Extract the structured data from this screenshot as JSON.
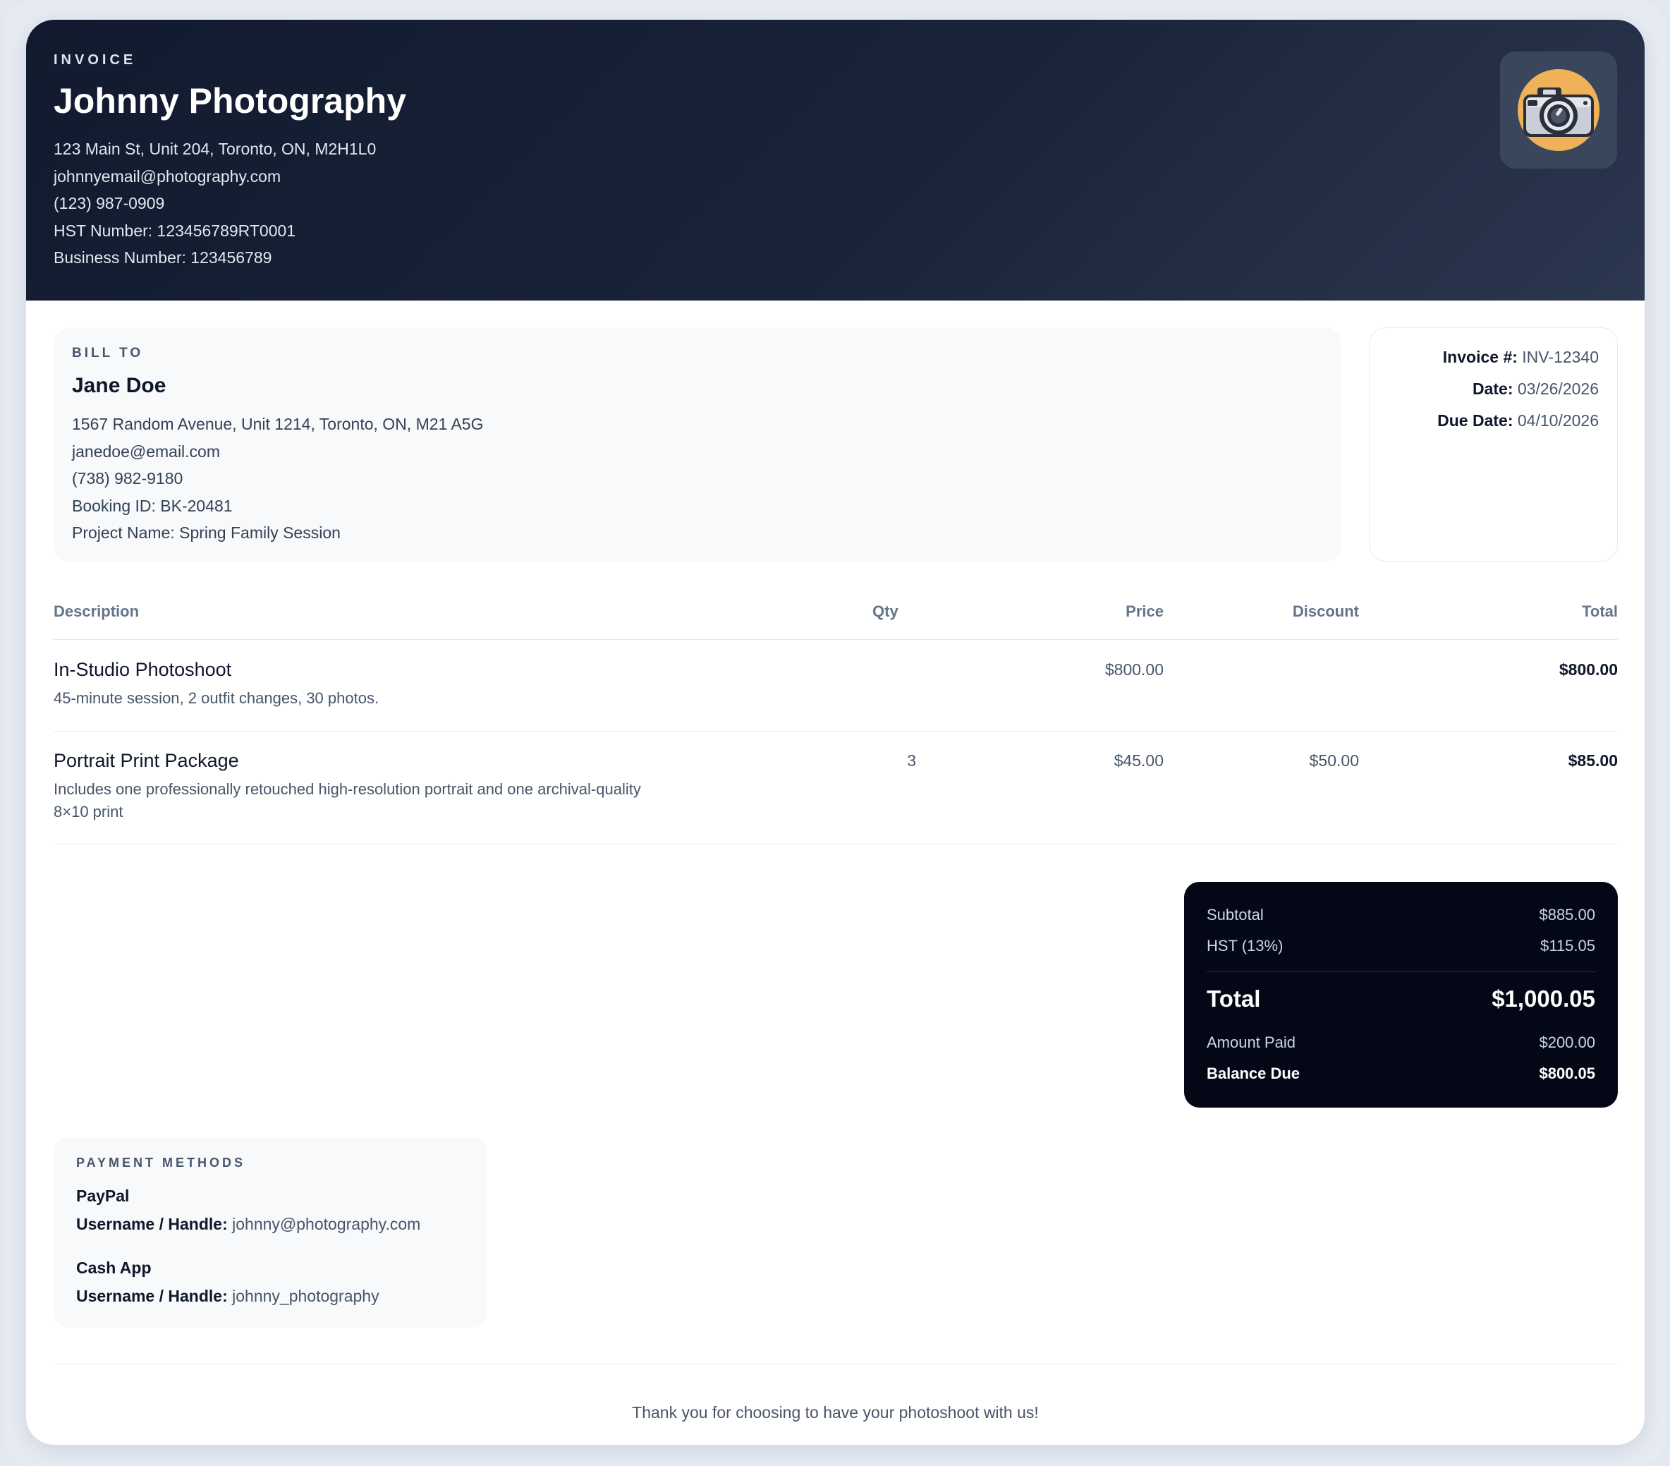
{
  "business": {
    "eyebrow": "INVOICE",
    "name": "Johnny Photography",
    "address": "123 Main St, Unit 204, Toronto, ON, M2H1L0",
    "email": "johnnyemail@photography.com",
    "phone": "(123) 987-0909",
    "hst": "HST Number: 123456789RT0001",
    "business_number": "Business Number: 123456789",
    "logo_icon": "camera-icon"
  },
  "bill_to": {
    "label": "BILL TO",
    "name": "Jane Doe",
    "address": "1567 Random Avenue, Unit 1214, Toronto, ON, M21 A5G",
    "email": "janedoe@email.com",
    "phone": "(738) 982-9180",
    "booking": "Booking ID: BK-20481",
    "project": "Project Name: Spring Family Session"
  },
  "meta": {
    "invoice_label": "Invoice #:",
    "invoice_value": "INV-12340",
    "date_label": "Date:",
    "date_value": "03/26/2026",
    "due_label": "Due Date:",
    "due_value": "04/10/2026"
  },
  "table": {
    "headers": {
      "description": "Description",
      "qty": "Qty",
      "price": "Price",
      "discount": "Discount",
      "total": "Total"
    },
    "rows": [
      {
        "title": "In-Studio Photoshoot",
        "desc": "45-minute session, 2 outfit changes, 30 photos.",
        "qty": "",
        "price": "$800.00",
        "discount": "",
        "total": "$800.00"
      },
      {
        "title": "Portrait Print Package",
        "desc": "Includes one professionally retouched high-resolution portrait and one archival-quality 8×10 print",
        "qty": "3",
        "price": "$45.00",
        "discount": "$50.00",
        "total": "$85.00"
      }
    ]
  },
  "summary": {
    "subtotal_label": "Subtotal",
    "subtotal_value": "$885.00",
    "hst_label": "HST (13%)",
    "hst_value": "$115.05",
    "total_label": "Total",
    "total_value": "$1,000.05",
    "paid_label": "Amount Paid",
    "paid_value": "$200.00",
    "balance_label": "Balance Due",
    "balance_value": "$800.05"
  },
  "payment": {
    "label": "PAYMENT METHODS",
    "methods": [
      {
        "name": "PayPal",
        "handle_label": "Username / Handle:",
        "handle": "johnny@photography.com"
      },
      {
        "name": "Cash App",
        "handle_label": "Username / Handle:",
        "handle": "johnny_photography"
      }
    ]
  },
  "footer": {
    "text": "Thank you for choosing to have your photoshoot with us!"
  },
  "colors": {
    "header_dark": "#111a2e",
    "summary_bg": "#040816",
    "logo_orange": "#f0b258"
  }
}
